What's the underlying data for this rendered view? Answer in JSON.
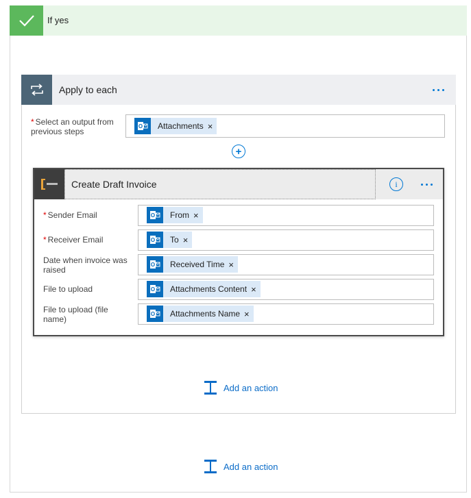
{
  "if_yes": {
    "title": "If yes"
  },
  "apply_each": {
    "title": "Apply to each",
    "select_label": "Select an output from previous steps",
    "select_token": "Attachments"
  },
  "draft_invoice": {
    "title": "Create Draft Invoice",
    "info_glyph": "i",
    "fields": [
      {
        "label": "Sender Email",
        "required": true,
        "token": "From"
      },
      {
        "label": "Receiver Email",
        "required": true,
        "token": "To"
      },
      {
        "label": "Date when invoice was raised",
        "required": false,
        "token": "Received Time"
      },
      {
        "label": "File to upload",
        "required": false,
        "token": "Attachments Content"
      },
      {
        "label": "File to upload (file name)",
        "required": false,
        "token": "Attachments Name"
      }
    ]
  },
  "add_action_inner": "Add an action",
  "add_action_outer": "Add an action",
  "remove_glyph": "×",
  "required_mark": "*",
  "colors": {
    "accent": "#0078d4",
    "success": "#5cb85c",
    "outlook": "#0a6ebd",
    "loop": "#4c6577"
  }
}
